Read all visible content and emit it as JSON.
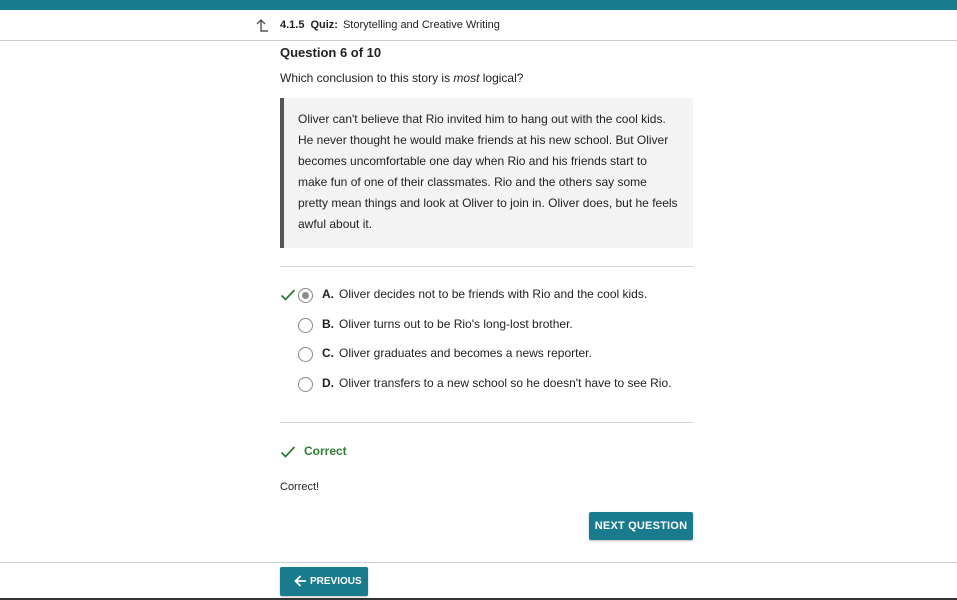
{
  "header": {
    "lesson_number": "4.1.5",
    "lesson_type": "Quiz:",
    "lesson_title": "Storytelling and Creative Writing"
  },
  "question": {
    "title": "Question 6 of 10",
    "prompt_before": "Which conclusion to this story is ",
    "prompt_emphasis": "most",
    "prompt_after": " logical?",
    "passage": "Oliver can't believe that Rio invited him to hang out with the cool kids. He never thought he would make friends at his new school. But Oliver becomes uncomfortable one day when Rio and his friends start to make fun of one of their classmates. Rio and the others say some pretty mean things and look at Oliver to join in. Oliver does, but he feels awful about it."
  },
  "choices": [
    {
      "letter": "A.",
      "text": "Oliver decides not to be friends with Rio and the cool kids.",
      "selected": true,
      "correct": true
    },
    {
      "letter": "B.",
      "text": "Oliver turns out to be Rio's long-lost brother.",
      "selected": false,
      "correct": false
    },
    {
      "letter": "C.",
      "text": "Oliver graduates and becomes a news reporter.",
      "selected": false,
      "correct": false
    },
    {
      "letter": "D.",
      "text": "Oliver transfers to a new school so he doesn't have to see Rio.",
      "selected": false,
      "correct": false
    }
  ],
  "result": {
    "label": "Correct",
    "feedback": "Correct!"
  },
  "buttons": {
    "next": "NEXT QUESTION",
    "previous": "PREVIOUS"
  },
  "colors": {
    "brand": "#1a7a8e",
    "correct": "#2e7d32"
  },
  "icons": {
    "header": "up-arrow-icon",
    "correct": "checkmark-icon",
    "previous": "arrow-left-icon"
  }
}
